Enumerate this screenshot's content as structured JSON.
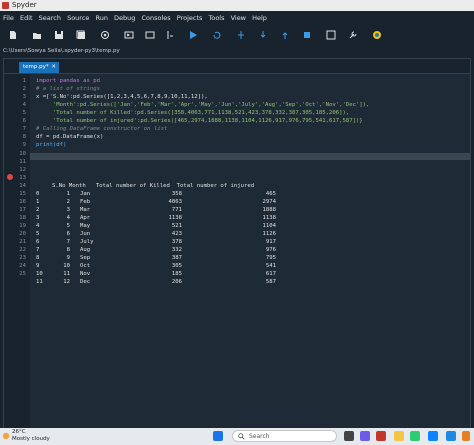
{
  "window": {
    "title": "Spyder"
  },
  "menu": [
    "File",
    "Edit",
    "Search",
    "Source",
    "Run",
    "Debug",
    "Consoles",
    "Projects",
    "Tools",
    "View",
    "Help"
  ],
  "path": "C:\\Users\\Sowya Sella\\.spyder-py3\\temp.py",
  "tab": {
    "label": "temp.py*",
    "close": "✕"
  },
  "code_lines": [
    "import pandas as pd",
    "# a list of strings",
    "x =['S.No':pd.Series([1,2,3,4,5,6,7,8,9,10,11,12]),",
    "     'Month':pd.Series(['Jan','Feb','Mar','Apr','May','Jun','July','Aug','Sep','Oct','Nov','Dec']),",
    "     'Total number of Killed':pd.Series([358,4063,771,1138,521,423,378,332,387,305,185,206]),",
    "     'Total number of injured':pd.Series([465,2974,1888,1138,1104,1126,917,976,795,541,617,587])}",
    "# Calling DataFrame constructor on list",
    "df = pd.DataFrame(x)",
    "print(df)",
    "",
    "",
    "",
    ""
  ],
  "output_header": [
    "S.No",
    "Month",
    "Total number of Killed",
    "Total number of injured"
  ],
  "output_rows": [
    [
      "0",
      "1",
      "Jan",
      "358",
      "465"
    ],
    [
      "1",
      "2",
      "Feb",
      "4063",
      "2974"
    ],
    [
      "2",
      "3",
      "Mar",
      "771",
      "1888"
    ],
    [
      "3",
      "4",
      "Apr",
      "1138",
      "1138"
    ],
    [
      "4",
      "5",
      "May",
      "521",
      "1104"
    ],
    [
      "5",
      "6",
      "Jun",
      "423",
      "1126"
    ],
    [
      "6",
      "7",
      "July",
      "378",
      "917"
    ],
    [
      "7",
      "8",
      "Aug",
      "332",
      "976"
    ],
    [
      "8",
      "9",
      "Sep",
      "387",
      "795"
    ],
    [
      "9",
      "10",
      "Oct",
      "305",
      "541"
    ],
    [
      "10",
      "11",
      "Nov",
      "185",
      "617"
    ],
    [
      "11",
      "12",
      "Dec",
      "206",
      "587"
    ]
  ],
  "line_numbers": [
    "1",
    "2",
    "3",
    "4",
    "5",
    "6",
    "7",
    "8",
    "9",
    "10",
    "11",
    "12",
    "13",
    "14",
    "15",
    "16",
    "17",
    "18",
    "19",
    "20",
    "21",
    "22",
    "23",
    "24",
    "25"
  ],
  "taskbar": {
    "temp": "26°C",
    "weather": "Mostly cloudy",
    "search": "Search"
  }
}
